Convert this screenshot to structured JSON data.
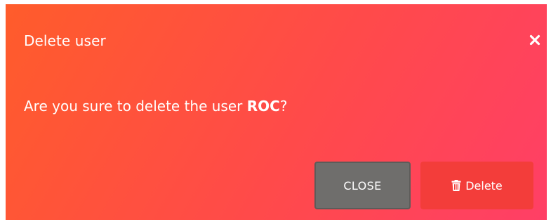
{
  "modal": {
    "title": "Delete user",
    "close_icon": "close-icon",
    "message_prefix": "Are you sure to delete the user ",
    "user_name": "ROC",
    "message_suffix": "?",
    "background": [
      "#ff5c2b",
      "#ff3f66"
    ]
  },
  "footer": {
    "close_label": "CLOSE",
    "delete_label": "Delete",
    "delete_icon": "trash-icon",
    "close_color": "#6f6e6c",
    "delete_color": "#f33d3a"
  }
}
